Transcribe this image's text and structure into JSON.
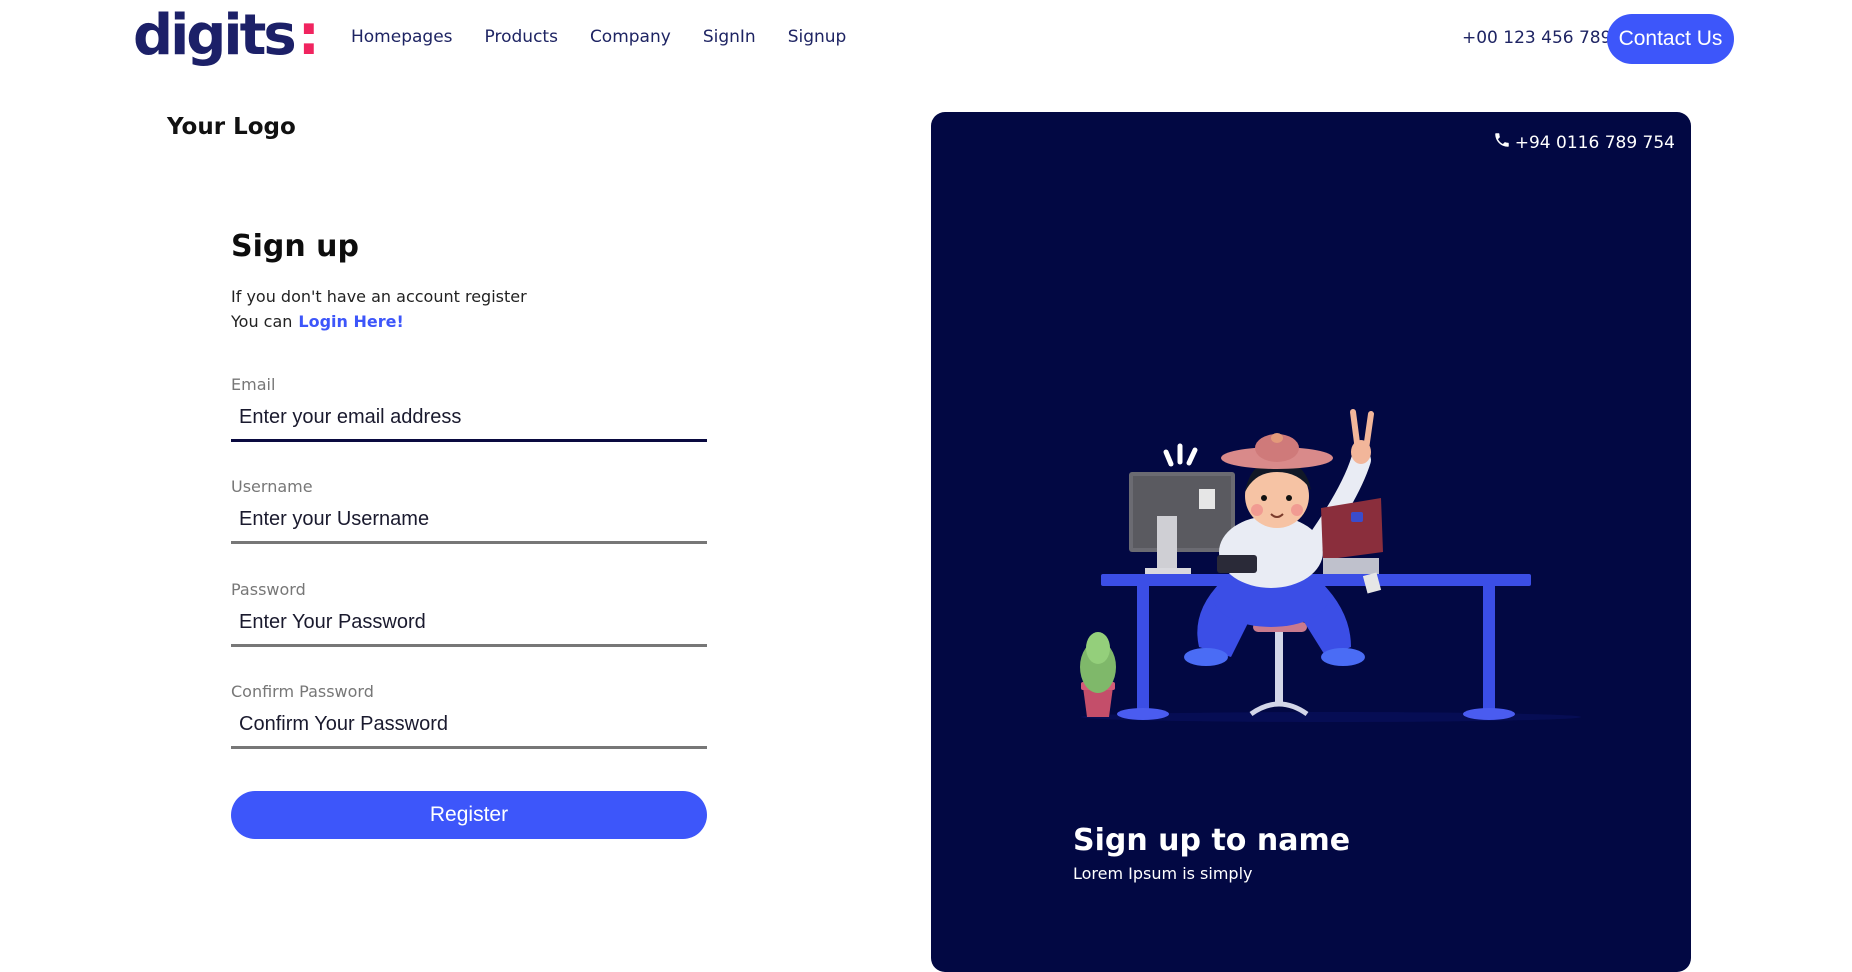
{
  "nav": {
    "brand": "digits",
    "brand_accent": ":",
    "links": [
      "Homepages",
      "Products",
      "Company",
      "SignIn",
      "Signup"
    ],
    "phone": "+00 123 456 789",
    "contact_label": "Contact Us"
  },
  "form": {
    "logo_text": "Your Logo",
    "title": "Sign up",
    "subtitle_line1": "If you don't have an account register",
    "subtitle_line2": "You can",
    "login_link": "Login Here!",
    "fields": [
      {
        "label": "Email",
        "placeholder": "Enter your email address"
      },
      {
        "label": "Username",
        "placeholder": "Enter your Username"
      },
      {
        "label": "Password",
        "placeholder": "Enter Your Password"
      },
      {
        "label": "Confirm Password",
        "placeholder": "Confirm Your Password"
      }
    ],
    "register_label": "Register"
  },
  "panel": {
    "phone": "+94 0116 789 754",
    "title": "Sign up to name",
    "subtitle": "Lorem Ipsum is simply",
    "phone_icon": "phone-icon",
    "illustration": "person-at-desk-illustration"
  },
  "colors": {
    "brand_navy": "#1c2068",
    "brand_accent": "#f0245f",
    "primary_blue": "#3d56fa",
    "panel_bg": "#020843"
  }
}
